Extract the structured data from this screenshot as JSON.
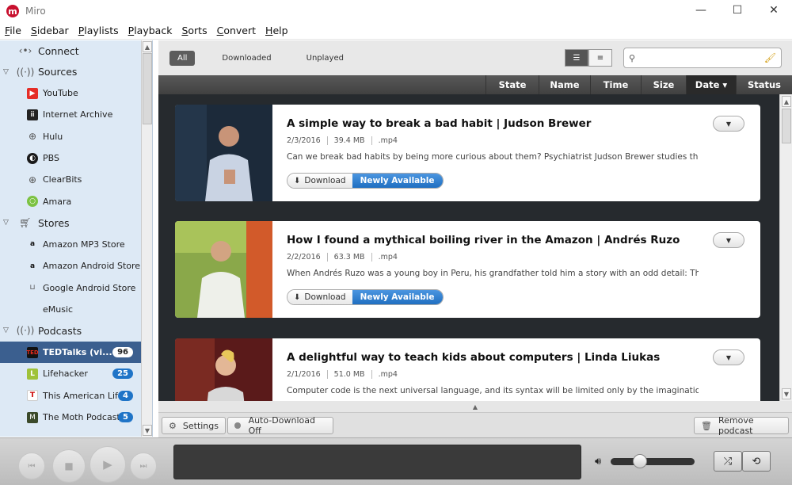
{
  "window": {
    "title": "Miro",
    "logo_letter": "m",
    "minimize": "—",
    "maximize": "☐",
    "close": "✕"
  },
  "menu": [
    {
      "first": "F",
      "rest": "ile"
    },
    {
      "first": "S",
      "rest": "idebar"
    },
    {
      "first": "P",
      "rest": "laylists"
    },
    {
      "first": "P",
      "rest": "layback"
    },
    {
      "first": "S",
      "rest": "orts"
    },
    {
      "first": "C",
      "rest": "onvert"
    },
    {
      "first": "H",
      "rest": "elp"
    }
  ],
  "sidebar": {
    "connect": "Connect",
    "sources": {
      "label": "Sources",
      "items": [
        {
          "label": "YouTube",
          "icon": "youtube-icon"
        },
        {
          "label": "Internet Archive",
          "icon": "archive-icon"
        },
        {
          "label": "Hulu",
          "icon": "globe-icon"
        },
        {
          "label": "PBS",
          "icon": "pbs-icon"
        },
        {
          "label": "ClearBits",
          "icon": "globe-icon"
        },
        {
          "label": "Amara",
          "icon": "amara-icon"
        }
      ]
    },
    "stores": {
      "label": "Stores",
      "items": [
        {
          "label": "Amazon MP3 Store",
          "icon": "amazon-icon"
        },
        {
          "label": "Amazon Android Store",
          "icon": "amazon-icon"
        },
        {
          "label": "Google Android Store",
          "icon": "cart-icon"
        },
        {
          "label": "eMusic",
          "icon": ""
        }
      ]
    },
    "podcasts": {
      "label": "Podcasts",
      "items": [
        {
          "label": "TEDTalks (vi...",
          "count": "96",
          "selected": true
        },
        {
          "label": "Lifehacker",
          "count": "25"
        },
        {
          "label": "This American Life",
          "count": "4"
        },
        {
          "label": "The Moth Podcast",
          "count": "5"
        }
      ]
    }
  },
  "filters": {
    "all": "All",
    "downloaded": "Downloaded",
    "unplayed": "Unplayed"
  },
  "search": {
    "placeholder": "",
    "value": ""
  },
  "columns": [
    "State",
    "Name",
    "Time",
    "Size",
    "Date ▾",
    "Status"
  ],
  "items": [
    {
      "title": "A simple way to break a bad habit | Judson Brewer",
      "date": "2/3/2016",
      "size": "39.4 MB",
      "format": ".mp4",
      "description": "Can we break bad habits by being more curious about them? Psychiatrist Judson Brewer studies the",
      "download_label": "Download",
      "status_badge": "Newly Available"
    },
    {
      "title": "How I found a mythical boiling river in the Amazon | Andrés Ruzo",
      "date": "2/2/2016",
      "size": "63.3 MB",
      "format": ".mp4",
      "description": "When Andrés Ruzo was a young boy in Peru, his grandfather told him a story with an odd detail: There",
      "download_label": "Download",
      "status_badge": "Newly Available"
    },
    {
      "title": "A delightful way to teach kids about computers | Linda Liukas",
      "date": "2/1/2016",
      "size": "51.0 MB",
      "format": ".mp4",
      "description": "Computer code is the next universal language, and its syntax will be limited only by the imaginations of",
      "download_label": "Download",
      "status_badge": "Newly Available"
    }
  ],
  "toolbar": {
    "settings": "Settings",
    "auto_download": "Auto-Download Off",
    "remove_podcast": "Remove podcast"
  },
  "colors": {
    "sidebar_bg": "#dde9f5",
    "selected_bg": "#3b5f8f",
    "badge_blue": "#1f74c7",
    "list_bg": "#262a2e"
  }
}
